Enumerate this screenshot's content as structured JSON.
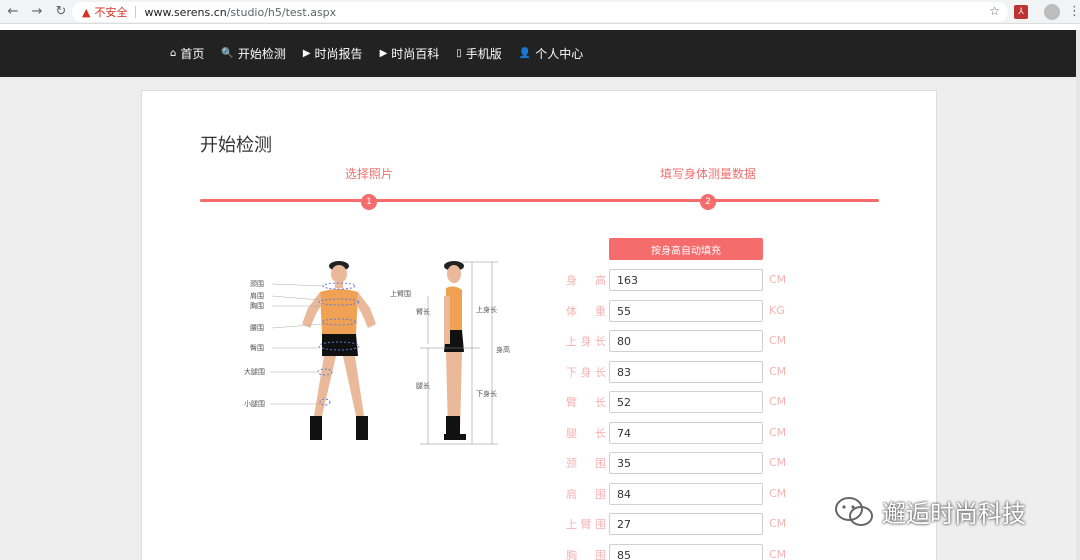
{
  "browser": {
    "insecure_label": "不安全",
    "url_host": "www.serens.cn",
    "url_path": "/studio/h5/test.aspx"
  },
  "nav": {
    "items": [
      {
        "icon": "home-icon",
        "glyph": "⌂",
        "label": "首页"
      },
      {
        "icon": "search-icon",
        "glyph": "🔍",
        "label": "开始检测"
      },
      {
        "icon": "play-circle-icon",
        "glyph": "▶",
        "label": "时尚报告"
      },
      {
        "icon": "play-circle-icon",
        "glyph": "▶",
        "label": "时尚百科"
      },
      {
        "icon": "mobile-icon",
        "glyph": "▯",
        "label": "手机版"
      },
      {
        "icon": "user-icon",
        "glyph": "👤",
        "label": "个人中心"
      }
    ]
  },
  "page": {
    "title": "开始检测",
    "steps": [
      {
        "label": "选择照片",
        "num": "1"
      },
      {
        "label": "填写身体测量数据",
        "num": "2"
      }
    ],
    "auto_fill_label": "按身高自动填充"
  },
  "figure": {
    "front_labels": [
      "颈围",
      "肩围",
      "胸围",
      "腰围",
      "臀围",
      "大腿围",
      "小腿围"
    ],
    "side_labels": {
      "upper_arm": "上臂围",
      "arm_len": "臂长",
      "upper_body": "上身长",
      "height": "身高",
      "leg_len": "腿长",
      "lower_body": "下身长"
    }
  },
  "form": {
    "rows": [
      {
        "label": "身高",
        "value": "163",
        "unit": "CM"
      },
      {
        "label": "体重",
        "value": "55",
        "unit": "KG"
      },
      {
        "label": "上身长",
        "value": "80",
        "unit": "CM"
      },
      {
        "label": "下身长",
        "value": "83",
        "unit": "CM"
      },
      {
        "label": "臂长",
        "value": "52",
        "unit": "CM"
      },
      {
        "label": "腿长",
        "value": "74",
        "unit": "CM"
      },
      {
        "label": "颈围",
        "value": "35",
        "unit": "CM"
      },
      {
        "label": "肩围",
        "value": "84",
        "unit": "CM"
      },
      {
        "label": "上臂围",
        "value": "27",
        "unit": "CM"
      },
      {
        "label": "胸围",
        "value": "85",
        "unit": "CM"
      }
    ]
  },
  "watermark": {
    "text": "邂逅时尚科技"
  }
}
